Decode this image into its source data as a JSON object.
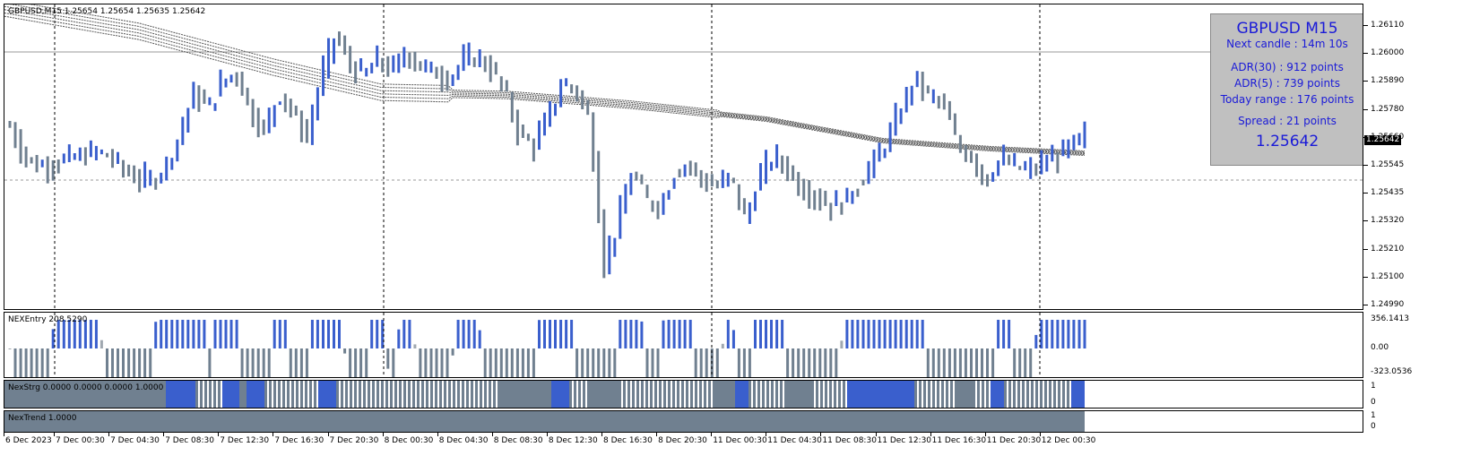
{
  "symbol_header": "GBPUSD,M15  1.25654 1.25654 1.25635 1.25642",
  "colors": {
    "bull": "#3a5fcd",
    "bear": "#708090",
    "grid": "#000000",
    "info_text": "#1a1ad8",
    "info_bg": "#c0c0c0"
  },
  "info_panel": {
    "title": "GBPUSD M15",
    "next_candle": "Next candle : 14m 10s",
    "adr30": "ADR(30) : 912 points",
    "adr5": "ADR(5) : 739 points",
    "today_range": "Today range : 176 points",
    "spread": "Spread : 21 points",
    "price": "1.25642"
  },
  "price_axis": {
    "labels": [
      "1.26110",
      "1.26000",
      "1.25890",
      "1.25780",
      "1.25660",
      "1.25545",
      "1.25435",
      "1.25320",
      "1.25210",
      "1.25100",
      "1.24990"
    ],
    "current": "1.25642"
  },
  "indicators": {
    "nexentry": {
      "title": "NEXEntry 208.5290",
      "labels": [
        "356.1413",
        "0.00",
        "-323.0536"
      ]
    },
    "nexstrg": {
      "title": "NexStrg 0.0000 0.0000 0.0000 1.0000",
      "labels": [
        "1",
        "0"
      ]
    },
    "nextrend": {
      "title": "NexTrend  1.0000",
      "labels": [
        "1",
        "0"
      ]
    }
  },
  "time_axis": [
    "6 Dec 2023",
    "7 Dec 00:30",
    "7 Dec 04:30",
    "7 Dec 08:30",
    "7 Dec 12:30",
    "7 Dec 16:30",
    "7 Dec 20:30",
    "8 Dec 00:30",
    "8 Dec 04:30",
    "8 Dec 08:30",
    "8 Dec 12:30",
    "8 Dec 16:30",
    "8 Dec 20:30",
    "11 Dec 00:30",
    "11 Dec 04:30",
    "11 Dec 08:30",
    "11 Dec 12:30",
    "11 Dec 16:30",
    "11 Dec 20:30",
    "12 Dec 00:30"
  ],
  "chart_data": {
    "type": "bar",
    "symbol": "GBPUSD",
    "timeframe": "M15",
    "ylim": [
      1.2494,
      1.2617
    ],
    "close_samples": [
      1.2568,
      1.2556,
      1.2552,
      1.2553,
      1.2555,
      1.2556,
      1.2558,
      1.2556,
      1.2551,
      1.2547,
      1.2546,
      1.2552,
      1.2565,
      1.2582,
      1.2575,
      1.2586,
      1.259,
      1.2574,
      1.2566,
      1.2582,
      1.2573,
      1.2564,
      1.2588,
      1.2605,
      1.2593,
      1.2588,
      1.2595,
      1.259,
      1.2598,
      1.2592,
      1.259,
      1.2587,
      1.2594,
      1.2596,
      1.2591,
      1.2582,
      1.2565,
      1.256,
      1.2571,
      1.2585,
      1.2583,
      1.257,
      1.2512,
      1.253,
      1.255,
      1.2538,
      1.2536,
      1.255,
      1.2553,
      1.2546,
      1.2544,
      1.2548,
      1.253,
      1.2548,
      1.2556,
      1.2551,
      1.2543,
      1.254,
      1.2536,
      1.2538,
      1.2545,
      1.2553,
      1.2562,
      1.2575,
      1.2588,
      1.258,
      1.2577,
      1.256,
      1.2556,
      1.2546,
      1.2555,
      1.2552,
      1.255,
      1.2553,
      1.2556,
      1.256,
      1.2564
    ]
  }
}
